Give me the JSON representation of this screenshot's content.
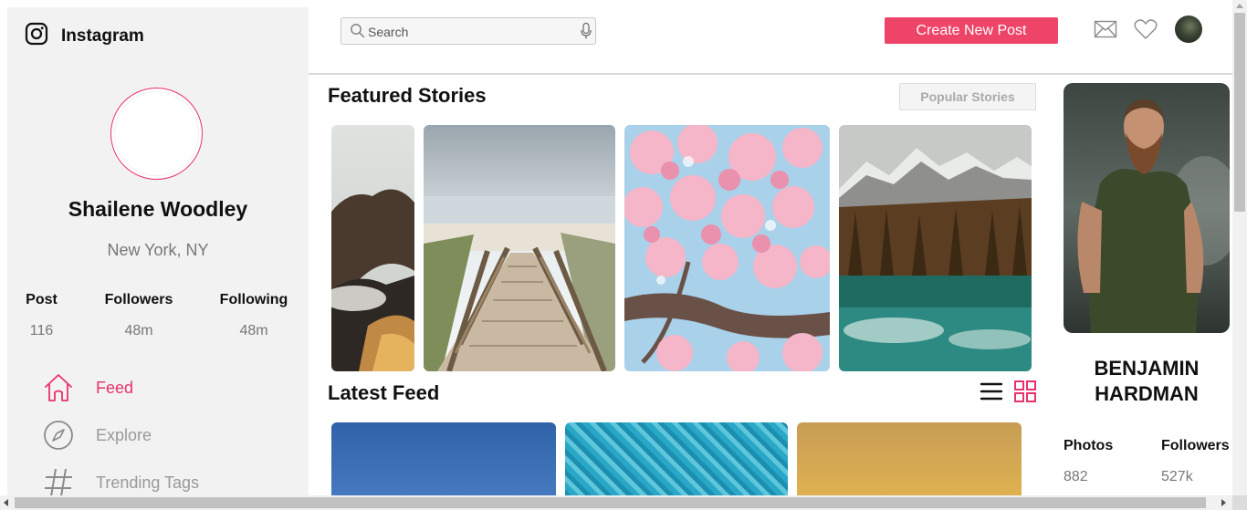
{
  "brand": {
    "name": "Instagram",
    "icon": "instagram-icon"
  },
  "profile": {
    "name": "Shailene Woodley",
    "location": "New York, NY",
    "stats": [
      {
        "label": "Post",
        "value": "116"
      },
      {
        "label": "Followers",
        "value": "48m"
      },
      {
        "label": "Following",
        "value": "48m"
      }
    ]
  },
  "nav": {
    "items": [
      {
        "label": "Feed",
        "icon": "home-icon",
        "active": true
      },
      {
        "label": "Explore",
        "icon": "compass-icon",
        "active": false
      },
      {
        "label": "Trending Tags",
        "icon": "hashtag-icon",
        "active": false
      }
    ]
  },
  "topbar": {
    "search_placeholder": "Search",
    "create_label": "Create New Post",
    "icons": [
      "mail-icon",
      "heart-icon",
      "user-avatar"
    ]
  },
  "stories": {
    "title": "Featured Stories",
    "button_label": "Popular Stories",
    "items": [
      "cliff-sea-clouds",
      "wooden-beach-stairs",
      "cherry-blossom",
      "mountain-lake-forest"
    ]
  },
  "feed": {
    "title": "Latest Feed",
    "view_icons": [
      "list-view-icon",
      "grid-view-icon"
    ],
    "items": [
      "blue-sky",
      "pool-water",
      "golden-sunset"
    ]
  },
  "featured_user": {
    "name_line1": "BENJAMIN",
    "name_line2": "HARDMAN",
    "stats": [
      {
        "label": "Photos",
        "value": "882"
      },
      {
        "label": "Followers",
        "value": "527k"
      }
    ]
  },
  "colors": {
    "accent": "#ed4468",
    "sidebar_bg": "#f2f2f2",
    "muted_text": "#777777"
  }
}
